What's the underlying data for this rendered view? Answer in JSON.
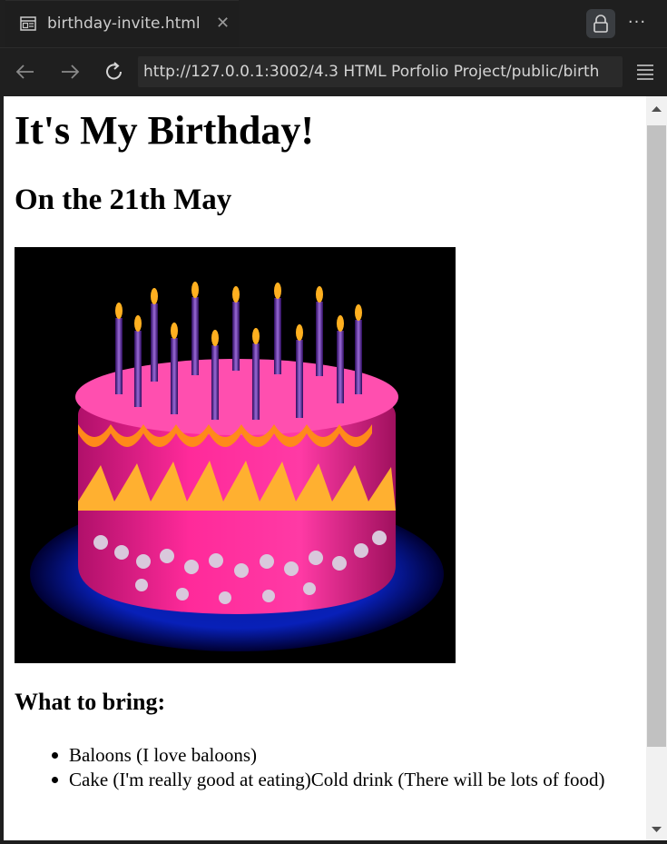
{
  "tab": {
    "title": "birthday-invite.html",
    "close_glyph": "✕",
    "icon": "page-preview-icon"
  },
  "toolbar": {
    "more_glyph": "···",
    "lock_icon": "lock-icon",
    "menu_icon": "hamburger-menu-icon"
  },
  "nav": {
    "back_icon": "arrow-left-icon",
    "forward_icon": "arrow-right-icon",
    "reload_icon": "reload-icon",
    "url": "http://127.0.0.1:3002/4.3 HTML Porfolio Project/public/birth"
  },
  "page": {
    "heading": "It's My Birthday!",
    "subheading": "On the 21th May",
    "image_alt": "birthday-cake",
    "bring_heading": "What to bring:",
    "items": [
      "Baloons (I love baloons)",
      "Cake (I'm really good at eating)Cold drink (There will be lots of food)"
    ]
  },
  "colors": {
    "chrome_bg": "#1f1f1f",
    "tab_text": "#cccccc",
    "page_bg": "#ffffff",
    "scroll_thumb": "#c1c1c1"
  }
}
